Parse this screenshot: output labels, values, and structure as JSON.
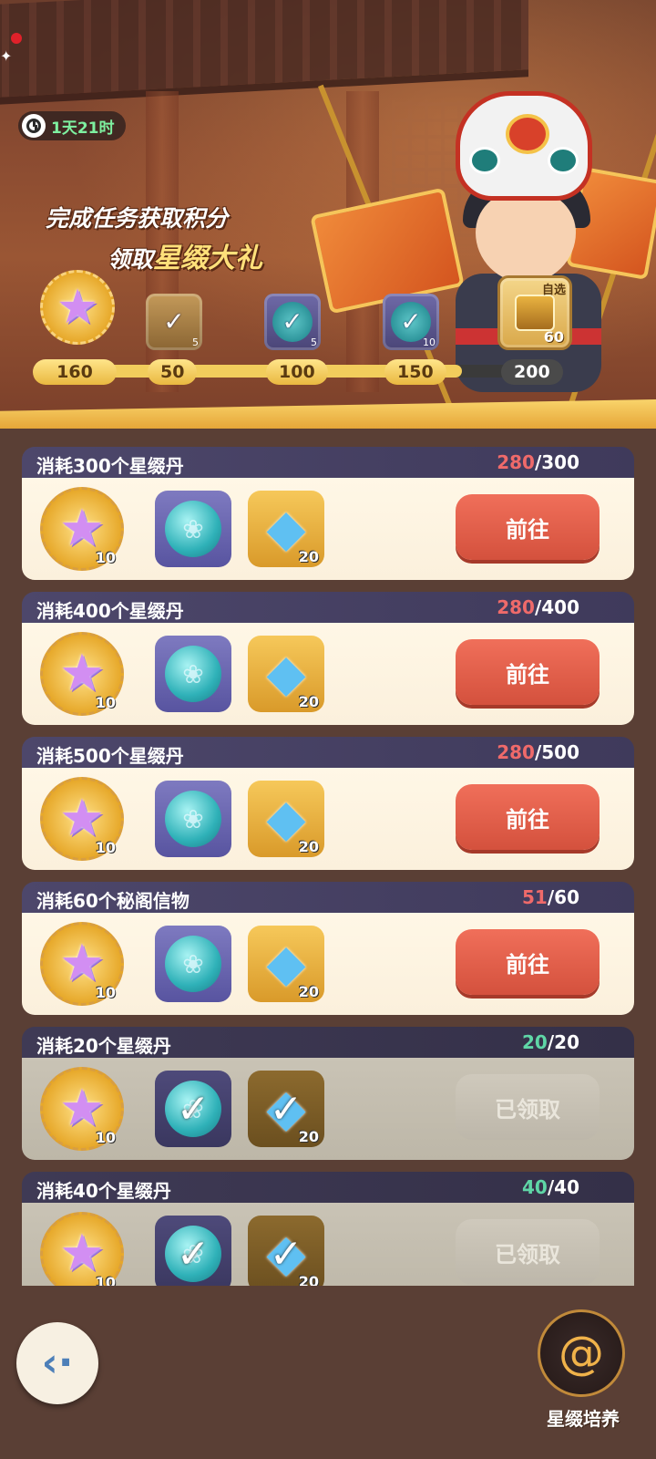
{
  "timer": {
    "text": "1天21时"
  },
  "slogan": {
    "line1": "完成任务获取积分",
    "line2_prefix": "领取",
    "line2_highlight": "星缀大礼"
  },
  "progress": {
    "current_points": "160",
    "fraction": 0.82,
    "milestones": [
      {
        "value": "50",
        "icon": "scroll-icon",
        "count": "5",
        "claimed": true
      },
      {
        "value": "100",
        "icon": "orb-check-icon",
        "count": "5",
        "claimed": true
      },
      {
        "value": "150",
        "icon": "orb-check-icon",
        "count": "10",
        "claimed": true
      },
      {
        "value": "200",
        "icon": "treasure-box-icon",
        "count": "60",
        "tag": "自选",
        "claimed": false
      }
    ]
  },
  "tasks": [
    {
      "title": "消耗300个星缀丹",
      "current": "280",
      "total": "/300",
      "status": "go",
      "button": "前往",
      "rewards": {
        "star": "10",
        "orb": "",
        "gem": "20"
      }
    },
    {
      "title": "消耗400个星缀丹",
      "current": "280",
      "total": "/400",
      "status": "go",
      "button": "前往",
      "rewards": {
        "star": "10",
        "orb": "",
        "gem": "20"
      }
    },
    {
      "title": "消耗500个星缀丹",
      "current": "280",
      "total": "/500",
      "status": "go",
      "button": "前往",
      "rewards": {
        "star": "10",
        "orb": "",
        "gem": "20"
      }
    },
    {
      "title": "消耗60个秘阁信物",
      "current": "51",
      "total": "/60",
      "status": "go",
      "button": "前往",
      "rewards": {
        "star": "10",
        "orb": "",
        "gem": "20"
      }
    },
    {
      "title": "消耗20个星缀丹",
      "current": "20",
      "total": "/20",
      "status": "claimed",
      "button": "已领取",
      "rewards": {
        "star": "10",
        "orb": "",
        "gem": "20"
      }
    },
    {
      "title": "消耗40个星缀丹",
      "current": "40",
      "total": "/40",
      "status": "claimed",
      "button": "已领取",
      "rewards": {
        "star": "10",
        "orb": "",
        "gem": "20"
      }
    }
  ],
  "footer": {
    "cultivate_label": "星缀培养"
  },
  "colors": {
    "accent_red": "#d4513d",
    "progress_gold": "#f2cd5c",
    "header_purple": "#4d476b"
  }
}
